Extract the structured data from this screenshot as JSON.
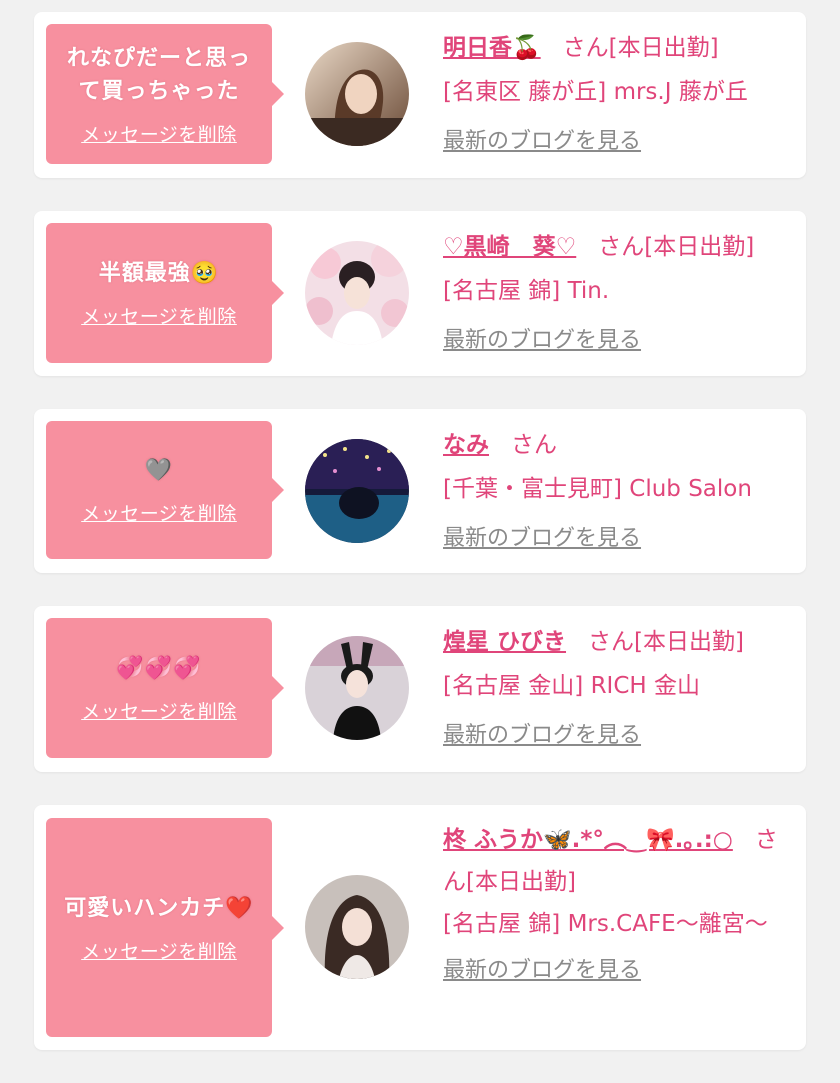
{
  "delete_label": "メッセージを削除",
  "blog_label": "最新のブログを見る",
  "san": "さん",
  "cards": [
    {
      "message": "れなぴだーと思って買っちゃった",
      "message_line1": "れなぴだーと思っ",
      "message_line2": "て買っちゃった",
      "name": "明日香🍒",
      "status": "[本日出勤]",
      "shop": "[名東区 藤が丘] mrs.J 藤が丘"
    },
    {
      "message": "半額最強🥹",
      "name": "♡黒崎　葵♡",
      "status": "[本日出勤]",
      "shop": "[名古屋 錦] Tin."
    },
    {
      "message": "🩶",
      "name": "なみ",
      "status": "",
      "shop": "[千葉・富士見町] Club Salon"
    },
    {
      "message": "💞💞💞",
      "name": "煌星 ひびき",
      "status": "[本日出勤]",
      "shop": "[名古屋 金山] RICH 金山"
    },
    {
      "message": "可愛いハンカチ❤️",
      "name": "柊 ふうか🦋.*°︵‿🎀.｡.:○",
      "status": "[本日出勤]",
      "shop": "[名古屋 錦] Mrs.CAFE〜離宮〜"
    }
  ],
  "colors": {
    "accent": "#e0457a",
    "bubble": "#f7909f",
    "background": "#f1f1f1",
    "muted": "#8a8a8a"
  }
}
